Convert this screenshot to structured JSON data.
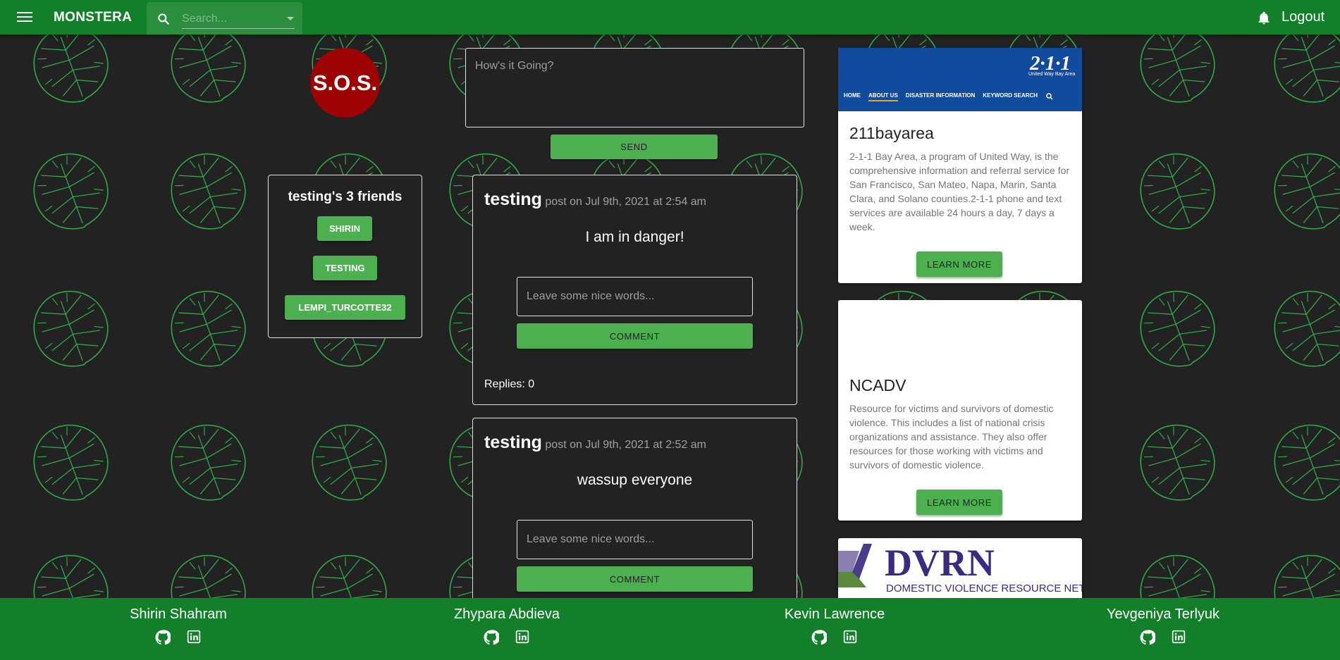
{
  "app": {
    "brand": "MONSTERA"
  },
  "header": {
    "search_placeholder": "Search...",
    "menu_icon": "hamburger-menu-icon",
    "bell_icon": "bell-icon",
    "logout_label": "Logout"
  },
  "sos": {
    "label": "S.O.S."
  },
  "friends": {
    "title": "testing's 3 friends",
    "items": [
      "SHIRIN",
      "TESTING",
      "LEMPI_TURCOTTE32"
    ]
  },
  "composer": {
    "placeholder": "How's it Going?",
    "send_label": "SEND"
  },
  "posts": [
    {
      "author": "testing",
      "meta": "post on Jul 9th, 2021 at 2:54 am",
      "body": "I am in danger!",
      "comment_placeholder": "Leave some nice words...",
      "comment_label": "COMMENT",
      "replies": "Replies: 0"
    },
    {
      "author": "testing",
      "meta": "post on Jul 9th, 2021 at 2:52 am",
      "body": "wassup everyone",
      "comment_placeholder": "Leave some nice words...",
      "comment_label": "COMMENT"
    }
  ],
  "resources": [
    {
      "banner": {
        "logo": "2·1·1",
        "logo_sub": "United Way Bay Area",
        "nav": [
          "HOME",
          "ABOUT US",
          "DISASTER INFORMATION",
          "KEYWORD SEARCH"
        ]
      },
      "title": "211bayarea",
      "description": "2-1-1 Bay Area, a program of United Way, is the comprehensive information and referral service for San Francisco, San Mateo, Napa, Marin, Santa Clara, and Solano counties.2-1-1 phone and text services are available 24 hours a day, 7 days a week.",
      "button": "LEARN MORE"
    },
    {
      "title": "NCADV",
      "description": "Resource for victims and survivors of domestic violence. This includes a list of national crisis organizations and assistance. They also offer resources for those working with victims and survivors of domestic violence.",
      "button": "LEARN MORE"
    },
    {
      "logo_text": "DVRN",
      "logo_sub": "DOMESTIC VIOLENCE RESOURCE NETWORK"
    }
  ],
  "footer": {
    "members": [
      {
        "name": "Shirin Shahram"
      },
      {
        "name": "Zhypara Abdieva"
      },
      {
        "name": "Kevin Lawrence"
      },
      {
        "name": "Yevgeniya Terlyuk"
      }
    ],
    "icons": [
      "github-icon",
      "linkedin-icon"
    ]
  },
  "colors": {
    "primary": "#137f2b",
    "button": "#4caf50",
    "background": "#222222",
    "sos": "#9e0303",
    "leaf": "#2fa84a"
  }
}
